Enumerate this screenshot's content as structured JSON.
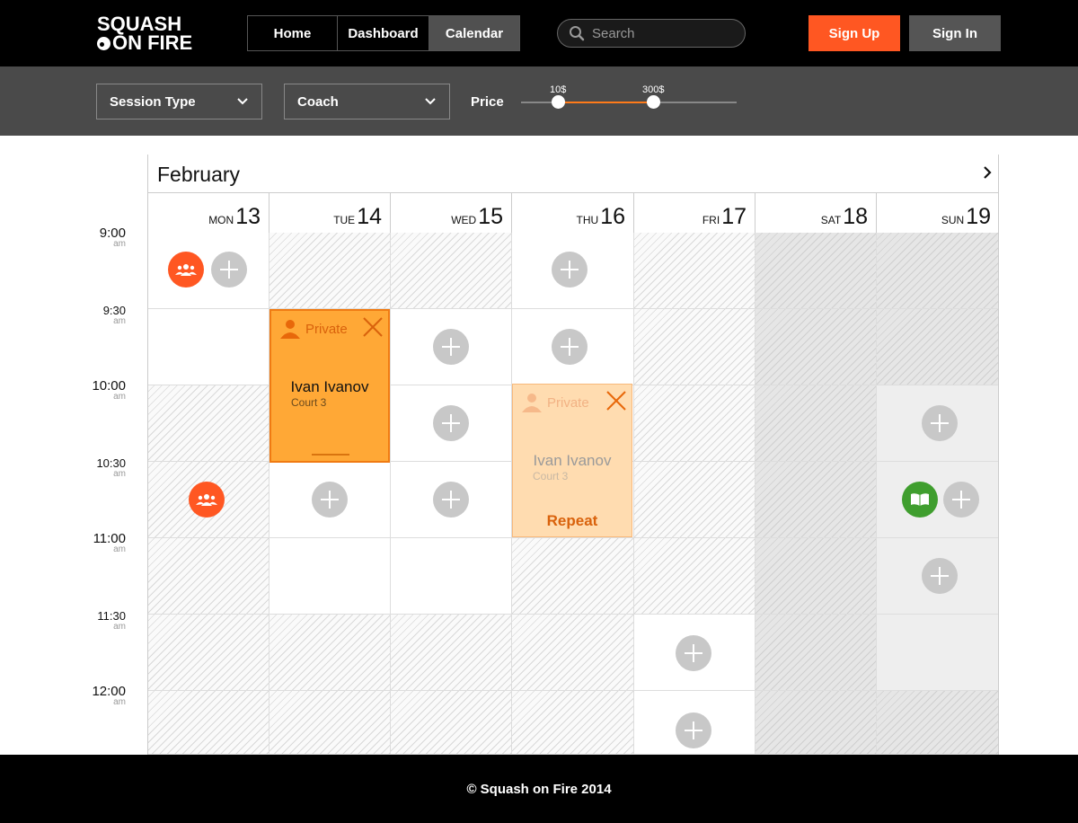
{
  "header": {
    "logo_line1": "SQUASH",
    "logo_line2": "ON FIRE",
    "nav": [
      "Home",
      "Dashboard",
      "Calendar"
    ],
    "active_nav": "Calendar",
    "search_placeholder": "Search",
    "signup_label": "Sign Up",
    "signin_label": "Sign In"
  },
  "filters": {
    "session_type_label": "Session Type",
    "coach_label": "Coach",
    "price_label": "Price",
    "price_min": "10$",
    "price_max": "300$"
  },
  "calendar": {
    "month": "February",
    "days": [
      {
        "name": "MON",
        "num": "13"
      },
      {
        "name": "TUE",
        "num": "14"
      },
      {
        "name": "WED",
        "num": "15"
      },
      {
        "name": "THU",
        "num": "16"
      },
      {
        "name": "FRI",
        "num": "17"
      },
      {
        "name": "SAT",
        "num": "18"
      },
      {
        "name": "SUN",
        "num": "19"
      }
    ],
    "times": [
      {
        "t": "9:00",
        "ampm": "am"
      },
      {
        "t": "9:30",
        "ampm": "am"
      },
      {
        "t": "10:00",
        "ampm": "am"
      },
      {
        "t": "10:30",
        "ampm": "am"
      },
      {
        "t": "11:00",
        "ampm": "am"
      },
      {
        "t": "11:30",
        "ampm": "am"
      },
      {
        "t": "12:00",
        "ampm": "am"
      }
    ],
    "events": [
      {
        "type": "Private",
        "name": "Ivan Ivanov",
        "court": "Court 3"
      },
      {
        "type": "Private",
        "name": "Ivan Ivanov",
        "court": "Court 3",
        "action": "Repeat"
      }
    ]
  },
  "footer": {
    "copyright": "© Squash on Fire 2014"
  },
  "colors": {
    "accent": "#ff5722",
    "event_orange": "#ffa836",
    "event_faded": "#ffdcb0",
    "green": "#3f9e2e"
  }
}
